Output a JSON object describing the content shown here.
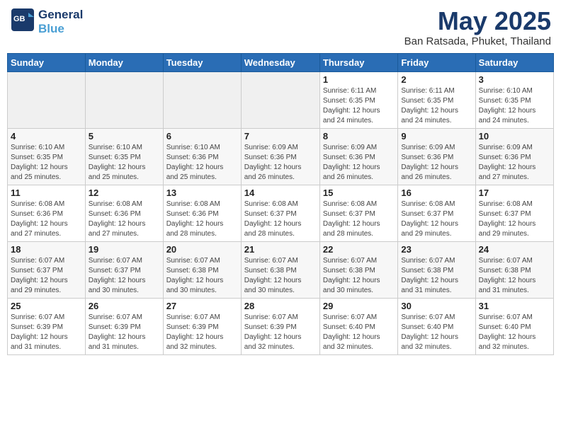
{
  "header": {
    "logo_line1": "General",
    "logo_line2": "Blue",
    "month_title": "May 2025",
    "location": "Ban Ratsada, Phuket, Thailand"
  },
  "weekdays": [
    "Sunday",
    "Monday",
    "Tuesday",
    "Wednesday",
    "Thursday",
    "Friday",
    "Saturday"
  ],
  "weeks": [
    [
      {
        "day": "",
        "info": ""
      },
      {
        "day": "",
        "info": ""
      },
      {
        "day": "",
        "info": ""
      },
      {
        "day": "",
        "info": ""
      },
      {
        "day": "1",
        "info": "Sunrise: 6:11 AM\nSunset: 6:35 PM\nDaylight: 12 hours\nand 24 minutes."
      },
      {
        "day": "2",
        "info": "Sunrise: 6:11 AM\nSunset: 6:35 PM\nDaylight: 12 hours\nand 24 minutes."
      },
      {
        "day": "3",
        "info": "Sunrise: 6:10 AM\nSunset: 6:35 PM\nDaylight: 12 hours\nand 24 minutes."
      }
    ],
    [
      {
        "day": "4",
        "info": "Sunrise: 6:10 AM\nSunset: 6:35 PM\nDaylight: 12 hours\nand 25 minutes."
      },
      {
        "day": "5",
        "info": "Sunrise: 6:10 AM\nSunset: 6:35 PM\nDaylight: 12 hours\nand 25 minutes."
      },
      {
        "day": "6",
        "info": "Sunrise: 6:10 AM\nSunset: 6:36 PM\nDaylight: 12 hours\nand 25 minutes."
      },
      {
        "day": "7",
        "info": "Sunrise: 6:09 AM\nSunset: 6:36 PM\nDaylight: 12 hours\nand 26 minutes."
      },
      {
        "day": "8",
        "info": "Sunrise: 6:09 AM\nSunset: 6:36 PM\nDaylight: 12 hours\nand 26 minutes."
      },
      {
        "day": "9",
        "info": "Sunrise: 6:09 AM\nSunset: 6:36 PM\nDaylight: 12 hours\nand 26 minutes."
      },
      {
        "day": "10",
        "info": "Sunrise: 6:09 AM\nSunset: 6:36 PM\nDaylight: 12 hours\nand 27 minutes."
      }
    ],
    [
      {
        "day": "11",
        "info": "Sunrise: 6:08 AM\nSunset: 6:36 PM\nDaylight: 12 hours\nand 27 minutes."
      },
      {
        "day": "12",
        "info": "Sunrise: 6:08 AM\nSunset: 6:36 PM\nDaylight: 12 hours\nand 27 minutes."
      },
      {
        "day": "13",
        "info": "Sunrise: 6:08 AM\nSunset: 6:36 PM\nDaylight: 12 hours\nand 28 minutes."
      },
      {
        "day": "14",
        "info": "Sunrise: 6:08 AM\nSunset: 6:37 PM\nDaylight: 12 hours\nand 28 minutes."
      },
      {
        "day": "15",
        "info": "Sunrise: 6:08 AM\nSunset: 6:37 PM\nDaylight: 12 hours\nand 28 minutes."
      },
      {
        "day": "16",
        "info": "Sunrise: 6:08 AM\nSunset: 6:37 PM\nDaylight: 12 hours\nand 29 minutes."
      },
      {
        "day": "17",
        "info": "Sunrise: 6:08 AM\nSunset: 6:37 PM\nDaylight: 12 hours\nand 29 minutes."
      }
    ],
    [
      {
        "day": "18",
        "info": "Sunrise: 6:07 AM\nSunset: 6:37 PM\nDaylight: 12 hours\nand 29 minutes."
      },
      {
        "day": "19",
        "info": "Sunrise: 6:07 AM\nSunset: 6:37 PM\nDaylight: 12 hours\nand 30 minutes."
      },
      {
        "day": "20",
        "info": "Sunrise: 6:07 AM\nSunset: 6:38 PM\nDaylight: 12 hours\nand 30 minutes."
      },
      {
        "day": "21",
        "info": "Sunrise: 6:07 AM\nSunset: 6:38 PM\nDaylight: 12 hours\nand 30 minutes."
      },
      {
        "day": "22",
        "info": "Sunrise: 6:07 AM\nSunset: 6:38 PM\nDaylight: 12 hours\nand 30 minutes."
      },
      {
        "day": "23",
        "info": "Sunrise: 6:07 AM\nSunset: 6:38 PM\nDaylight: 12 hours\nand 31 minutes."
      },
      {
        "day": "24",
        "info": "Sunrise: 6:07 AM\nSunset: 6:38 PM\nDaylight: 12 hours\nand 31 minutes."
      }
    ],
    [
      {
        "day": "25",
        "info": "Sunrise: 6:07 AM\nSunset: 6:39 PM\nDaylight: 12 hours\nand 31 minutes."
      },
      {
        "day": "26",
        "info": "Sunrise: 6:07 AM\nSunset: 6:39 PM\nDaylight: 12 hours\nand 31 minutes."
      },
      {
        "day": "27",
        "info": "Sunrise: 6:07 AM\nSunset: 6:39 PM\nDaylight: 12 hours\nand 32 minutes."
      },
      {
        "day": "28",
        "info": "Sunrise: 6:07 AM\nSunset: 6:39 PM\nDaylight: 12 hours\nand 32 minutes."
      },
      {
        "day": "29",
        "info": "Sunrise: 6:07 AM\nSunset: 6:40 PM\nDaylight: 12 hours\nand 32 minutes."
      },
      {
        "day": "30",
        "info": "Sunrise: 6:07 AM\nSunset: 6:40 PM\nDaylight: 12 hours\nand 32 minutes."
      },
      {
        "day": "31",
        "info": "Sunrise: 6:07 AM\nSunset: 6:40 PM\nDaylight: 12 hours\nand 32 minutes."
      }
    ]
  ]
}
